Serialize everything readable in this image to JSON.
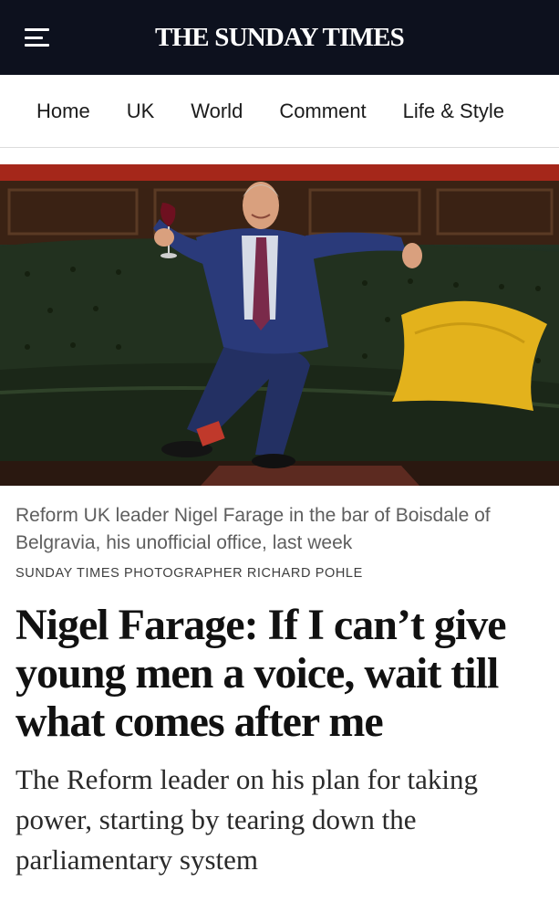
{
  "masthead": {
    "title": "THE SUNDAY TIMES"
  },
  "nav": {
    "items": [
      "Home",
      "UK",
      "World",
      "Comment",
      "Life & Style"
    ]
  },
  "article": {
    "caption": "Reform UK leader Nigel Farage in the bar of Boisdale of Belgravia, his unofficial office, last week",
    "credit": "SUNDAY TIMES PHOTOGRAPHER RICHARD POHLE",
    "headline": "Nigel Farage: If I can’t give young men a voice, wait till what comes after me",
    "standfirst": "The Reform leader on his plan for taking power, starting by tearing down the parliamentary system"
  },
  "colors": {
    "topbar": "#0d111e",
    "masthead_text": "#ffffff",
    "cushion": "#e3b21c",
    "sofa": "#1f2d1f"
  },
  "icons": {
    "menu": "hamburger-menu-icon"
  }
}
